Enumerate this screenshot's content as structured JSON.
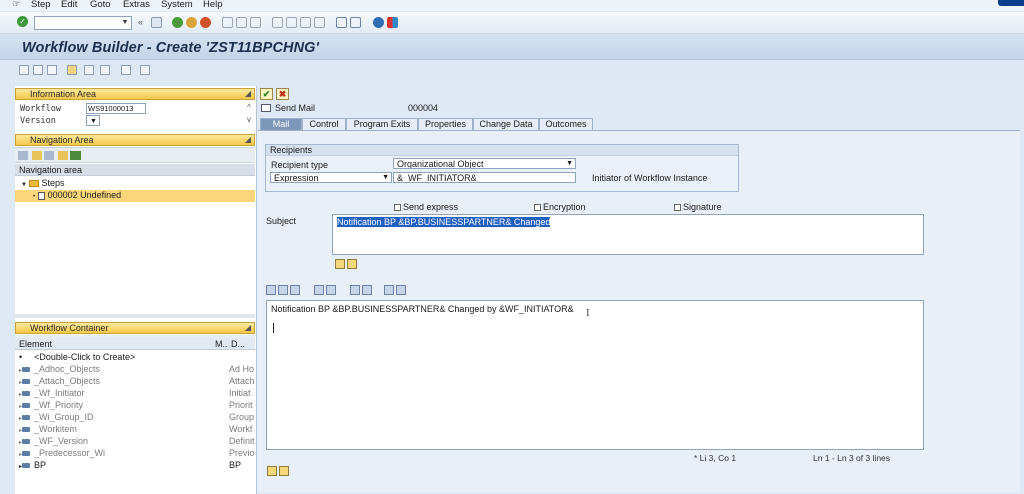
{
  "menu": [
    "Step",
    "Edit",
    "Goto",
    "Extras",
    "System",
    "Help"
  ],
  "window_title": "Workflow Builder - Create 'ZST11BPCHNG'",
  "info_area": {
    "title": "Information Area",
    "workflow_label": "Workflow",
    "workflow_value": "WS91000013",
    "version_label": "Version"
  },
  "nav_area": {
    "title": "Navigation Area",
    "column_header": "Navigation area",
    "tree": [
      "Steps",
      "000002 Undefined"
    ]
  },
  "workflow_container": {
    "title": "Workflow Container",
    "columns": [
      "Element",
      "M..",
      "D..."
    ],
    "rows": [
      {
        "name": "<Double-Click to Create>",
        "desc": ""
      },
      {
        "name": "_Adhoc_Objects",
        "desc": "Ad Ho"
      },
      {
        "name": "_Attach_Objects",
        "desc": "Attach"
      },
      {
        "name": "_Wf_Initiator",
        "desc": "Initiat"
      },
      {
        "name": "_Wf_Priority",
        "desc": "Priorit"
      },
      {
        "name": "_Wi_Group_ID",
        "desc": "Group"
      },
      {
        "name": "_Workitem",
        "desc": "Workf"
      },
      {
        "name": "_WF_Version",
        "desc": "Definit"
      },
      {
        "name": "_Predecessor_Wi",
        "desc": "Previo"
      },
      {
        "name": "BP",
        "desc": "BP"
      }
    ]
  },
  "step": {
    "type": "Send Mail",
    "number": "000004"
  },
  "tabs": [
    "Mail",
    "Control",
    "Program Exits",
    "Properties",
    "Change Data",
    "Outcomes"
  ],
  "recipients": {
    "title": "Recipients",
    "recipient_type_label": "Recipient type",
    "recipient_type_value": "Organizational Object",
    "expression_type": "Expression",
    "expression_value": "&_WF_INITIATOR&",
    "expression_desc": "Initiator of Workflow Instance"
  },
  "options": {
    "send_express": "Send express",
    "encryption": "Encryption",
    "signature": "Signature"
  },
  "subject_label": "Subject",
  "subject_value": "Notification BP &BP.BUSINESSPARTNER& Changed",
  "body_text": "Notification BP &BP.BUSINESSPARTNER& Changed by &WF_INITIATOR&",
  "status": {
    "cursor": "* Li 3, Co 1",
    "lines": "Ln 1 - Ln 3 of 3 lines"
  }
}
